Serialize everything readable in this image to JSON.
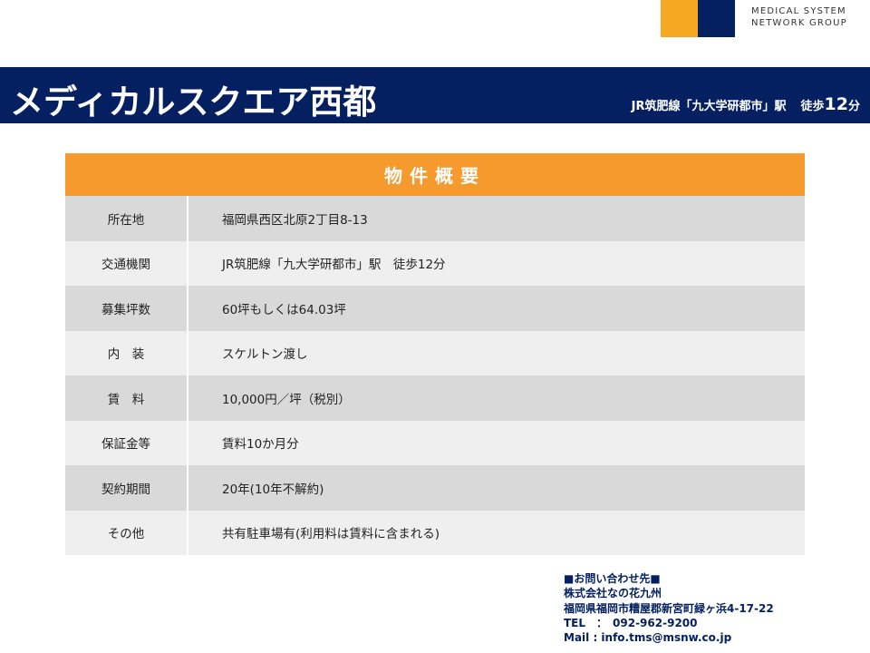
{
  "logo": {
    "line1": "MEDICAL SYSTEM",
    "line2": "NETWORK GROUP",
    "colors": {
      "orange": "#f7a823",
      "navy": "#042060"
    }
  },
  "header": {
    "title": "メディカルスクエア西都",
    "station": "JR筑肥線「九大学研都市」駅",
    "walk_label": "徒歩",
    "walk_num": "12",
    "walk_unit": "分"
  },
  "table": {
    "heading": "物件概要",
    "rows": [
      {
        "label": "所在地",
        "value": "福岡県西区北原2丁目8-13"
      },
      {
        "label": "交通機関",
        "value": "JR筑肥線「九大学研都市」駅　徒歩12分"
      },
      {
        "label": "募集坪数",
        "value": "60坪もしくは64.03坪"
      },
      {
        "label": "内　装",
        "value": "スケルトン渡し"
      },
      {
        "label": "賃　料",
        "value": "10,000円／坪（税別）"
      },
      {
        "label": "保証金等",
        "value": "賃料10か月分"
      },
      {
        "label": "契約期間",
        "value": "20年(10年不解約)"
      },
      {
        "label": "その他",
        "value": "共有駐車場有(利用料は賃料に含まれる)"
      }
    ]
  },
  "contact": {
    "heading": "■お問い合わせ先■",
    "company": "株式会社なの花九州",
    "address": "福岡県福岡市糟屋郡新宮町緑ヶ浜4-17-22",
    "tel": "TEL　：　092-962-9200",
    "mail": "Mail : info.tms@msnw.co.jp"
  }
}
